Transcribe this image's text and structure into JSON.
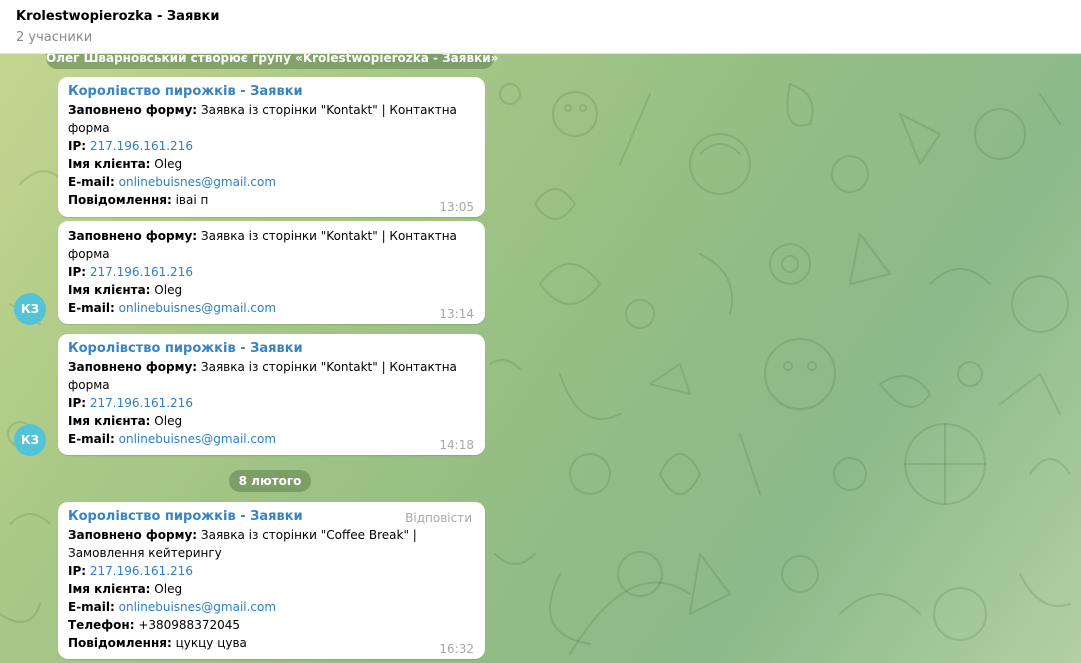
{
  "header": {
    "title": "Krolestwopierozka - Заявки",
    "subtitle": "2 учасники"
  },
  "service_message": "Олег Шварновський створює групу «Krolestwopierozka - Заявки»",
  "date_separator": "8 лютого",
  "reply_label": "Відповісти",
  "avatar_initials": "КЗ",
  "messages": [
    {
      "sender": "Королівство пирожків - Заявки",
      "form_label": "Заповнено форму:",
      "form_value_1": "Заявка із сторінки \"Kontakt\" | Контактна",
      "form_value_2": "форма",
      "ip_label": "IP:",
      "ip": "217.196.161.216",
      "name_label": "Імя клієнта:",
      "name": "Oleg",
      "email_label": "E-mail:",
      "email": "onlinebuisnes@gmail.com",
      "note_label": "Повідомлення:",
      "note": "іваі п",
      "time": "13:05"
    },
    {
      "form_label": "Заповнено форму:",
      "form_value_1": "Заявка із сторінки \"Kontakt\" | Контактна",
      "form_value_2": "форма",
      "ip_label": "IP:",
      "ip": "217.196.161.216",
      "name_label": "Імя клієнта:",
      "name": "Oleg",
      "email_label": "E-mail:",
      "email": "onlinebuisnes@gmail.com",
      "time": "13:14"
    },
    {
      "sender": "Королівство пирожків - Заявки",
      "form_label": "Заповнено форму:",
      "form_value_1": "Заявка із сторінки \"Kontakt\" | Контактна",
      "form_value_2": "форма",
      "ip_label": "IP:",
      "ip": "217.196.161.216",
      "name_label": "Імя клієнта:",
      "name": "Oleg",
      "email_label": "E-mail:",
      "email": "onlinebuisnes@gmail.com",
      "time": "14:18"
    },
    {
      "sender": "Королівство пирожків - Заявки",
      "form_label": "Заповнено форму:",
      "form_value_1": "Заявка із сторінки \"Coffee Break\" |",
      "form_value_2": "Замовлення кейтерингу",
      "ip_label": "IP:",
      "ip": "217.196.161.216",
      "name_label": "Імя клієнта:",
      "name": "Oleg",
      "email_label": "E-mail:",
      "email": "onlinebuisnes@gmail.com",
      "phone_label": "Телефон:",
      "phone": "+380988372045",
      "note_label": "Повідомлення:",
      "note": "цукцу цува",
      "time": "16:32"
    }
  ],
  "colors": {
    "sender": "#3a84c0",
    "link": "#2e7fc4",
    "avatar": "#54c3d6",
    "time": "#a8a8a8"
  }
}
